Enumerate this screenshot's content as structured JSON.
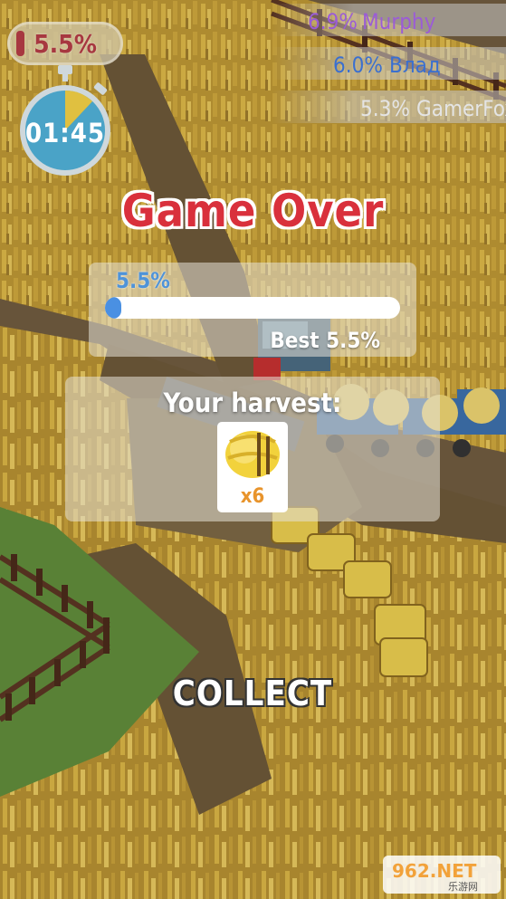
{
  "hud": {
    "player_percent": "5.5%",
    "timer": "01:45",
    "timer_progress": 0.12,
    "leaderboard": [
      {
        "percent": "6.9%",
        "name": "Murphy",
        "color": "#9b5cd6"
      },
      {
        "percent": "6.0%",
        "name": "Влад",
        "color": "#3a6fd0"
      },
      {
        "percent": "5.3%",
        "name": "GamerFox",
        "color": "#d8d8d8"
      }
    ]
  },
  "result": {
    "title": "Game Over",
    "progress_label": "5.5%",
    "progress_value": 0.055,
    "best_label": "Best 5.5%",
    "harvest_label": "Your harvest:",
    "harvest_item": "hay-bale-icon",
    "harvest_count": "x6",
    "collect_label": "COLLECT"
  },
  "colors": {
    "title": "#d9303c",
    "accent": "#4a90e2",
    "field": "#c9a23a",
    "grass": "#5f8a3a",
    "road": "#6e5a3e"
  },
  "watermark": {
    "text": "962.NET",
    "subtext": "乐游网"
  }
}
